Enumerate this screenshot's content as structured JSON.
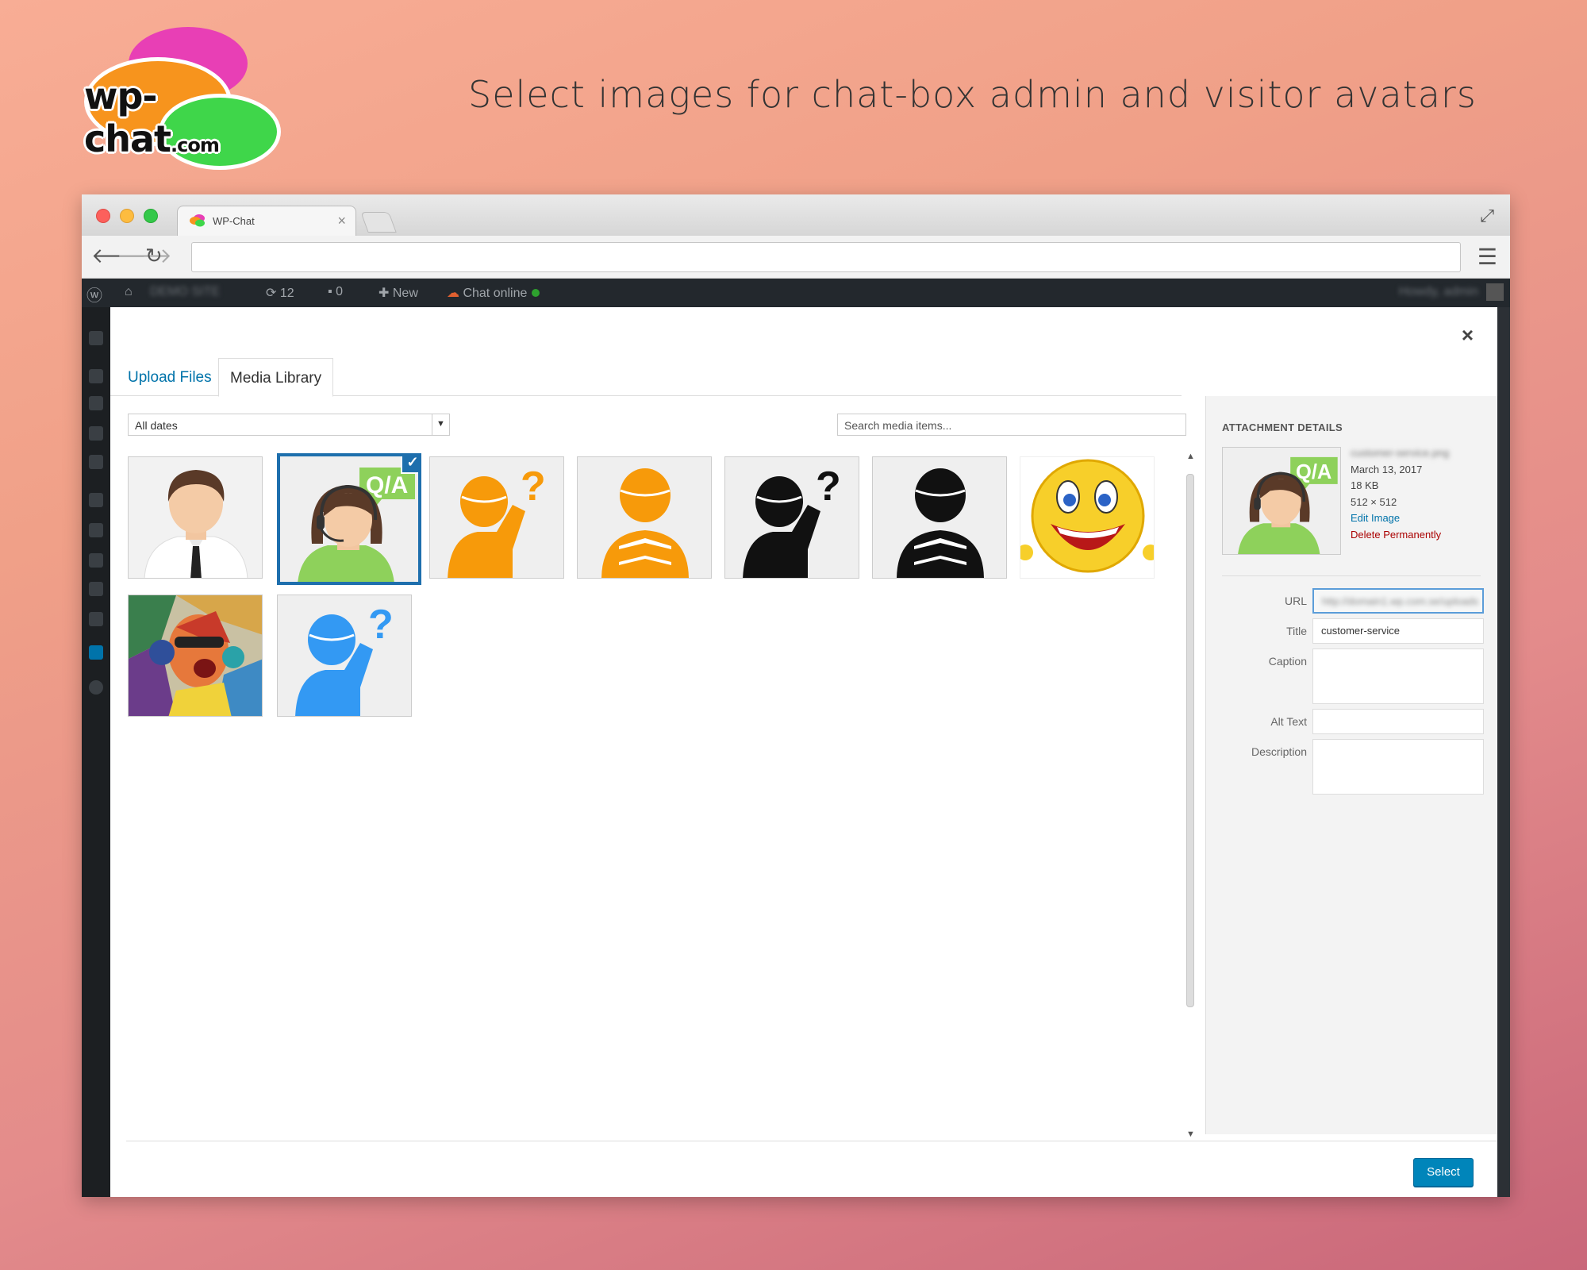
{
  "promo": {
    "logo_text": "wp-chat",
    "logo_suffix": ".com",
    "headline": "Select images for chat-box admin and visitor avatars"
  },
  "browser": {
    "tab_title": "WP-Chat",
    "tab_close": "×"
  },
  "adminbar": {
    "site_name": "DEMO SITE",
    "updates_count": "12",
    "comments_count": "0",
    "new_label": "New",
    "chat_label": "Chat online",
    "howdy": "Howdy, admin"
  },
  "modal": {
    "close": "×",
    "tabs": [
      "Upload Files",
      "Media Library"
    ],
    "active_tab": "Media Library",
    "date_filter": "All dates",
    "search_placeholder": "Search media items...",
    "attachments": [
      {
        "name": "businessman-avatar",
        "selected": false
      },
      {
        "name": "customer-service",
        "selected": true
      },
      {
        "name": "orange-question",
        "selected": false
      },
      {
        "name": "orange-reading",
        "selected": false
      },
      {
        "name": "black-question",
        "selected": false
      },
      {
        "name": "black-reading",
        "selected": false
      },
      {
        "name": "smiley",
        "selected": false
      },
      {
        "name": "dj-colorful",
        "selected": false
      },
      {
        "name": "blue-question",
        "selected": false
      }
    ]
  },
  "details": {
    "heading": "ATTACHMENT DETAILS",
    "filename": "customer-service.png",
    "date": "March 13, 2017",
    "size": "18 KB",
    "dimensions": "512 × 512",
    "edit_link": "Edit Image",
    "delete_link": "Delete Permanently",
    "fields": {
      "url_label": "URL",
      "url_value": "http://domain1.wp.com.se/uploads",
      "title_label": "Title",
      "title_value": "customer-service",
      "caption_label": "Caption",
      "alt_label": "Alt Text",
      "description_label": "Description"
    },
    "select_button": "Select"
  },
  "colors": {
    "wp_blue": "#0073aa",
    "selected_border": "#1e6fad",
    "delete_red": "#aa0000",
    "button_blue": "#0085ba"
  }
}
